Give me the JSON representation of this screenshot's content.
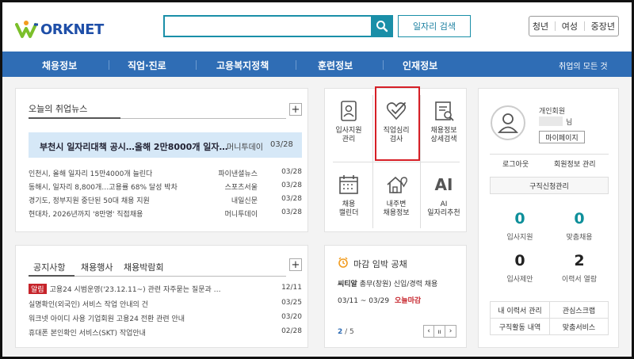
{
  "header": {
    "logo_text": "ORKNET",
    "search_placeholder": "",
    "job_search_label": "일자리 검색",
    "user_links": [
      "청년",
      "여성",
      "중장년"
    ]
  },
  "nav": {
    "items": [
      "채용정보",
      "직업·진로",
      "고용복지정책",
      "훈련정보",
      "인재정보"
    ],
    "all_label": "취업의 모든 것"
  },
  "news": {
    "tab_label": "오늘의 취업뉴스",
    "plus": "+",
    "headline": {
      "title": "부천시 일자리대책 공시…올해 2만8000개 일자…",
      "source": "머니투데이",
      "date": "03/28"
    },
    "rows": [
      {
        "title": "인천시, 올해 일자리 15만4000개 늘린다",
        "source": "파이낸셜뉴스",
        "date": "03/28"
      },
      {
        "title": "동해시, 일자리 8,800개…고용률 68% 달성 박차",
        "source": "스포츠서울",
        "date": "03/28"
      },
      {
        "title": "경기도, 정부지원 중단된 50대 채용 지원",
        "source": "내일신문",
        "date": "03/28"
      },
      {
        "title": "현대차, 2026년까지 '8만명' 직접채용",
        "source": "머니투데이",
        "date": "03/28"
      }
    ]
  },
  "notice": {
    "tabs": [
      "공지사항",
      "채용행사",
      "채용박람회"
    ],
    "plus": "+",
    "badge": "알림",
    "rows": [
      {
        "title": "고용24 시범운영('23.12.11~) 관련 자주묻는 질문과 …",
        "date": "12/11"
      },
      {
        "title": "실명확인(외국인) 서비스 작업 안내의 건",
        "date": "03/25"
      },
      {
        "title": "워크넷 아이디 사용 기업회원 고용24 전환 관련 안내",
        "date": "03/20"
      },
      {
        "title": "휴대폰 본인확인 서비스(SKT) 작업안내",
        "date": "02/28"
      }
    ]
  },
  "services": {
    "items": [
      {
        "line1": "입사지원",
        "line2": "관리",
        "icon": "id-card-icon"
      },
      {
        "line1": "직업심리",
        "line2": "검사",
        "icon": "heart-check-icon"
      },
      {
        "line1": "채용정보",
        "line2": "상세검색",
        "icon": "document-search-icon"
      },
      {
        "line1": "채용",
        "line2": "캘린더",
        "icon": "calendar-icon"
      },
      {
        "line1": "내주변",
        "line2": "채용정보",
        "icon": "house-pin-icon"
      },
      {
        "line1": "AI",
        "line2": "일자리추천",
        "icon": "ai-icon"
      }
    ]
  },
  "deadline": {
    "title": "마감 임박 공채",
    "company": "씨티알",
    "job": "총무(창원) 신입/경력 채용",
    "period": "03/11 ~ 03/29",
    "status": "오늘마감",
    "page_current": "2",
    "page_total": "/ 5",
    "status_color": "#c6242b"
  },
  "member": {
    "type": "개인회원",
    "name_suffix": "님",
    "mypage_label": "마이페이지",
    "logout_label": "로그아웃",
    "info_label": "회원정보 관리",
    "apply_manage_label": "구직신청관리",
    "stats": [
      {
        "value": "0",
        "label": "입사지원"
      },
      {
        "value": "0",
        "label": "맞춤채용"
      },
      {
        "value": "0",
        "label": "입사제안"
      },
      {
        "value": "2",
        "label": "이력서 열람"
      }
    ],
    "links": [
      "내 이력서 관리",
      "관심스크랩",
      "구직활동 내역",
      "맞춤서비스"
    ],
    "accent_color": "#0e8f9a"
  }
}
